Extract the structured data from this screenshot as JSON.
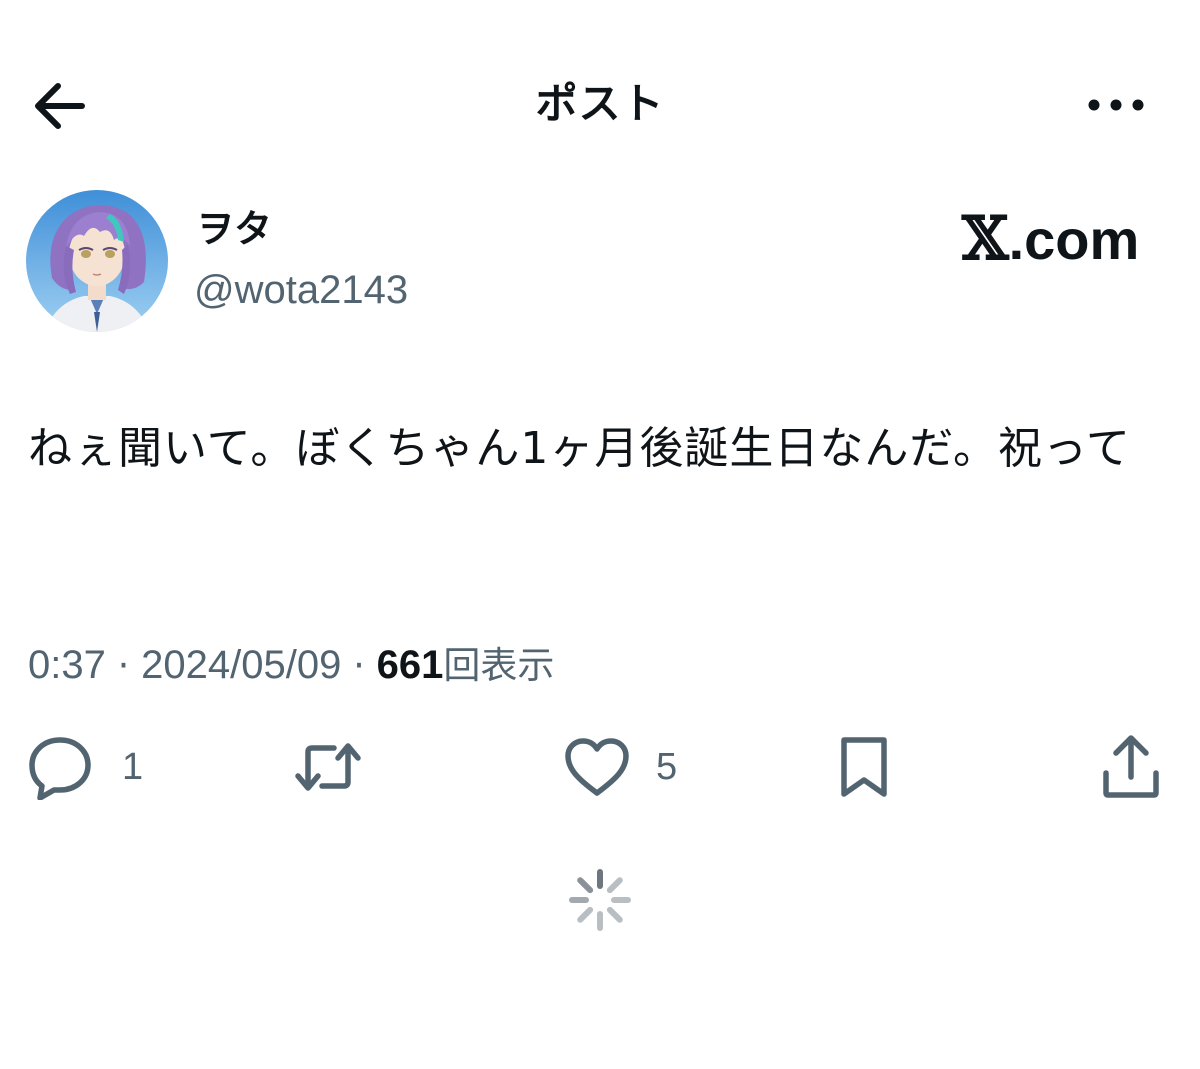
{
  "header": {
    "title": "ポスト",
    "back_icon": "arrow-left-icon",
    "more_icon": "more-horizontal-icon"
  },
  "author": {
    "display_name": "ヲタ",
    "handle": "@wota2143",
    "avatar_icon": "avatar-anime-purple-hair"
  },
  "brand": {
    "mark": "𝕏",
    "suffix": ".com"
  },
  "post": {
    "text": "ねぇ聞いて。ぼくちゃん1ヶ月後誕生日なんだ。祝って"
  },
  "meta": {
    "time": "0:37",
    "separator": "·",
    "date": "2024/05/09",
    "views_count": "661",
    "views_label": "回表示"
  },
  "actions": {
    "reply_count": "1",
    "like_count": "5"
  },
  "colors": {
    "text_primary": "#0f1419",
    "text_secondary": "#536471",
    "background": "#ffffff"
  }
}
